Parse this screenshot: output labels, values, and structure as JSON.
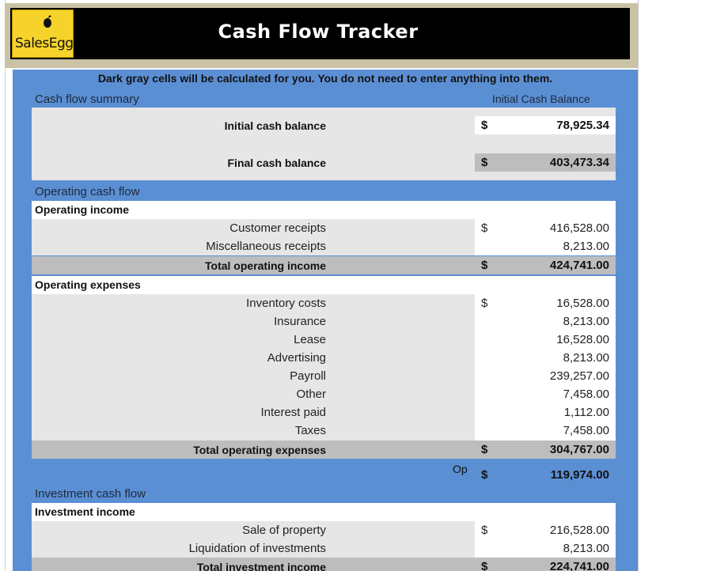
{
  "header": {
    "logo_text": "SalesEgg",
    "title": "Cash Flow Tracker"
  },
  "notice": "Dark gray cells will be calculated for you. You do not need to enter anything into them.",
  "summary": {
    "section_label": "Cash flow summary",
    "column_label": "Initial Cash Balance",
    "initial_label": "Initial cash balance",
    "initial_currency": "$",
    "initial_value": "78,925.34",
    "final_label": "Final cash balance",
    "final_currency": "$",
    "final_value": "403,473.34"
  },
  "operating": {
    "section_label": "Operating cash flow",
    "income_heading": "Operating income",
    "income_rows": [
      {
        "label": "Customer receipts",
        "currency": "$",
        "value": "416,528.00"
      },
      {
        "label": "Miscellaneous receipts",
        "currency": "",
        "value": "8,213.00"
      }
    ],
    "income_total": {
      "label": "Total operating income",
      "currency": "$",
      "value": "424,741.00"
    },
    "expenses_heading": "Operating expenses",
    "expense_rows": [
      {
        "label": "Inventory costs",
        "currency": "$",
        "value": "16,528.00"
      },
      {
        "label": "Insurance",
        "currency": "",
        "value": "8,213.00"
      },
      {
        "label": "Lease",
        "currency": "",
        "value": "16,528.00"
      },
      {
        "label": "Advertising",
        "currency": "",
        "value": "8,213.00"
      },
      {
        "label": "Payroll",
        "currency": "",
        "value": "239,257.00"
      },
      {
        "label": "Other",
        "currency": "",
        "value": "7,458.00"
      },
      {
        "label": "Interest paid",
        "currency": "",
        "value": "1,112.00"
      },
      {
        "label": "Taxes",
        "currency": "",
        "value": "7,458.00"
      }
    ],
    "expenses_total": {
      "label": "Total operating expenses",
      "currency": "$",
      "value": "304,767.00"
    },
    "net_label": "Op",
    "net_currency": "$",
    "net_value": "119,974.00"
  },
  "investment": {
    "section_label": "Investment cash flow",
    "income_heading": "Investment income",
    "income_rows": [
      {
        "label": "Sale of property",
        "currency": "$",
        "value": "216,528.00"
      },
      {
        "label": "Liquidation of investments",
        "currency": "",
        "value": "8,213.00"
      }
    ],
    "income_total": {
      "label": "Total investment income",
      "currency": "$",
      "value": "224,741.00"
    }
  },
  "colors": {
    "panel_blue": "#5b8fd4",
    "header_black": "#000000",
    "logo_yellow": "#f6d32a",
    "calc_gray": "#bdbdbd",
    "input_gray": "#e6e6e6"
  }
}
